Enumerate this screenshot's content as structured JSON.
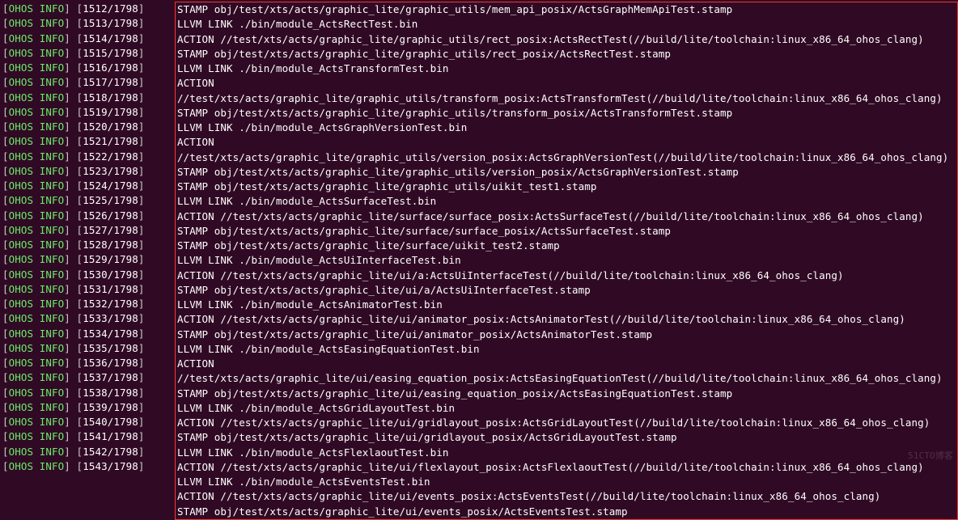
{
  "rows": [
    {
      "cnt": "1512",
      "msg": "STAMP obj/test/xts/acts/graphic_lite/graphic_utils/mem_api_posix/ActsGraphMemApiTest.stamp"
    },
    {
      "cnt": "1513",
      "msg": "LLVM LINK ./bin/module_ActsRectTest.bin"
    },
    {
      "cnt": "1514",
      "msg": "ACTION //test/xts/acts/graphic_lite/graphic_utils/rect_posix:ActsRectTest(//build/lite/toolchain:linux_x86_64_ohos_clang)"
    },
    {
      "cnt": "1515",
      "msg": "STAMP obj/test/xts/acts/graphic_lite/graphic_utils/rect_posix/ActsRectTest.stamp"
    },
    {
      "cnt": "1516",
      "msg": "LLVM LINK ./bin/module_ActsTransformTest.bin"
    },
    {
      "cnt": "1517",
      "msg": "ACTION //test/xts/acts/graphic_lite/graphic_utils/transform_posix:ActsTransformTest(//build/lite/toolchain:linux_x86_64_ohos_clang)"
    },
    {
      "cnt": "1518",
      "msg": "STAMP obj/test/xts/acts/graphic_lite/graphic_utils/transform_posix/ActsTransformTest.stamp"
    },
    {
      "cnt": "1519",
      "msg": "LLVM LINK ./bin/module_ActsGraphVersionTest.bin"
    },
    {
      "cnt": "1520",
      "msg": "ACTION //test/xts/acts/graphic_lite/graphic_utils/version_posix:ActsGraphVersionTest(//build/lite/toolchain:linux_x86_64_ohos_clang)"
    },
    {
      "cnt": "1521",
      "msg": "STAMP obj/test/xts/acts/graphic_lite/graphic_utils/version_posix/ActsGraphVersionTest.stamp"
    },
    {
      "cnt": "1522",
      "msg": "STAMP obj/test/xts/acts/graphic_lite/graphic_utils/uikit_test1.stamp"
    },
    {
      "cnt": "1523",
      "msg": "LLVM LINK ./bin/module_ActsSurfaceTest.bin"
    },
    {
      "cnt": "1524",
      "msg": "ACTION //test/xts/acts/graphic_lite/surface/surface_posix:ActsSurfaceTest(//build/lite/toolchain:linux_x86_64_ohos_clang)"
    },
    {
      "cnt": "1525",
      "msg": "STAMP obj/test/xts/acts/graphic_lite/surface/surface_posix/ActsSurfaceTest.stamp"
    },
    {
      "cnt": "1526",
      "msg": "STAMP obj/test/xts/acts/graphic_lite/surface/uikit_test2.stamp"
    },
    {
      "cnt": "1527",
      "msg": "LLVM LINK ./bin/module_ActsUiInterfaceTest.bin"
    },
    {
      "cnt": "1528",
      "msg": "ACTION //test/xts/acts/graphic_lite/ui/a:ActsUiInterfaceTest(//build/lite/toolchain:linux_x86_64_ohos_clang)"
    },
    {
      "cnt": "1529",
      "msg": "STAMP obj/test/xts/acts/graphic_lite/ui/a/ActsUiInterfaceTest.stamp"
    },
    {
      "cnt": "1530",
      "msg": "LLVM LINK ./bin/module_ActsAnimatorTest.bin"
    },
    {
      "cnt": "1531",
      "msg": "ACTION //test/xts/acts/graphic_lite/ui/animator_posix:ActsAnimatorTest(//build/lite/toolchain:linux_x86_64_ohos_clang)"
    },
    {
      "cnt": "1532",
      "msg": "STAMP obj/test/xts/acts/graphic_lite/ui/animator_posix/ActsAnimatorTest.stamp"
    },
    {
      "cnt": "1533",
      "msg": "LLVM LINK ./bin/module_ActsEasingEquationTest.bin"
    },
    {
      "cnt": "1534",
      "msg": "ACTION //test/xts/acts/graphic_lite/ui/easing_equation_posix:ActsEasingEquationTest(//build/lite/toolchain:linux_x86_64_ohos_clang)"
    },
    {
      "cnt": "1535",
      "msg": "STAMP obj/test/xts/acts/graphic_lite/ui/easing_equation_posix/ActsEasingEquationTest.stamp"
    },
    {
      "cnt": "1536",
      "msg": "LLVM LINK ./bin/module_ActsGridLayoutTest.bin"
    },
    {
      "cnt": "1537",
      "msg": "ACTION //test/xts/acts/graphic_lite/ui/gridlayout_posix:ActsGridLayoutTest(//build/lite/toolchain:linux_x86_64_ohos_clang)"
    },
    {
      "cnt": "1538",
      "msg": "STAMP obj/test/xts/acts/graphic_lite/ui/gridlayout_posix/ActsGridLayoutTest.stamp"
    },
    {
      "cnt": "1539",
      "msg": "LLVM LINK ./bin/module_ActsFlexlaoutTest.bin"
    },
    {
      "cnt": "1540",
      "msg": "ACTION //test/xts/acts/graphic_lite/ui/flexlayout_posix:ActsFlexlaoutTest(//build/lite/toolchain:linux_x86_64_ohos_clang)"
    },
    {
      "cnt": "1541",
      "msg": "LLVM LINK ./bin/module_ActsEventsTest.bin"
    },
    {
      "cnt": "1542",
      "msg": "ACTION //test/xts/acts/graphic_lite/ui/events_posix:ActsEventsTest(//build/lite/toolchain:linux_x86_64_ohos_clang)"
    },
    {
      "cnt": "1543",
      "msg": "STAMP obj/test/xts/acts/graphic_lite/ui/events_posix/ActsEventsTest.stamp"
    }
  ],
  "total": "1798",
  "prefix": "OHOS INFO",
  "watermark": "51CTO博客"
}
